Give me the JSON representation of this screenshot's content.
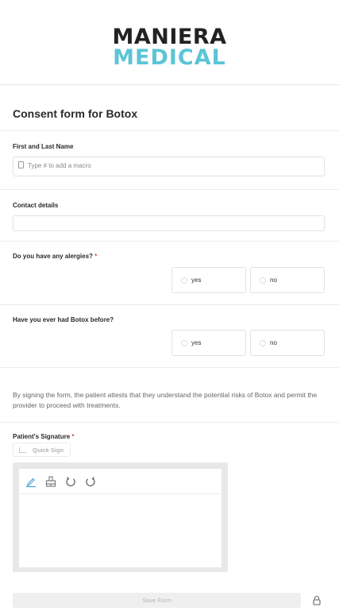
{
  "brand": {
    "line1": "MANIERA",
    "line2": "MEDICAL",
    "accent_color": "#5bc5d6"
  },
  "form": {
    "title": "Consent form for Botox"
  },
  "fields": {
    "name": {
      "label": "First and Last Name",
      "placeholder": "Type # to add a macro",
      "icon": "document-icon"
    },
    "contact": {
      "label": "Contact details",
      "value": ""
    },
    "allergies": {
      "label": "Do you have any alergies?",
      "required_mark": "*",
      "options": [
        "yes",
        "no"
      ]
    },
    "botox_before": {
      "label": "Have you ever had Botox before?",
      "options": [
        "yes",
        "no"
      ]
    }
  },
  "statement": "By signing the form, the patient attests that they understand the potential risks of Botox and permit the provider to proceed with treatments.",
  "signature": {
    "label": "Patient's Signature",
    "required_mark": "*",
    "quick_sign_label": "Quick Sign",
    "tools": [
      "pen-icon",
      "stamp-icon",
      "undo-icon",
      "redo-icon"
    ]
  },
  "footer": {
    "save_label": "Save Form",
    "lock_icon": "lock-icon"
  }
}
